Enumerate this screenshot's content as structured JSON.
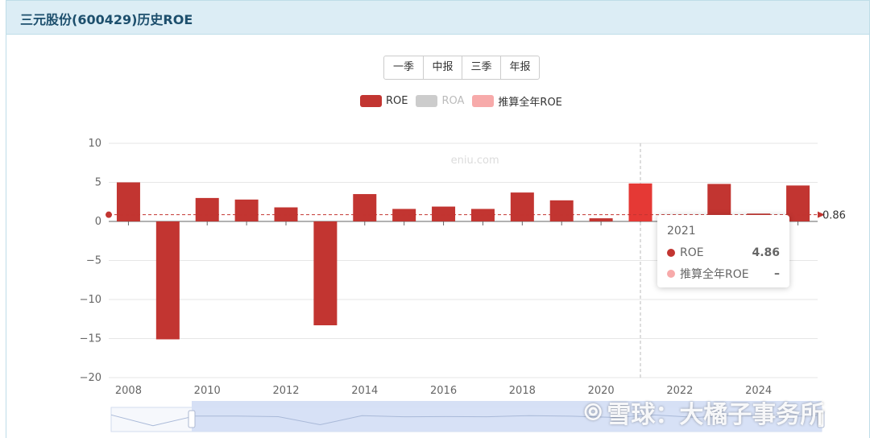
{
  "header": {
    "title": "三元股份(600429)历史ROE"
  },
  "period_buttons": [
    "一季",
    "中报",
    "三季",
    "年报"
  ],
  "colors": {
    "roe": "#c23531",
    "roa": "#cccccc",
    "estimate": "#f7aaaa",
    "hover_bar": "#e53935",
    "markline": "#c23531"
  },
  "chart_data": {
    "type": "bar",
    "legend": [
      "ROE",
      "ROA",
      "推算全年ROE"
    ],
    "legend_inactive": [
      "ROA"
    ],
    "x": [
      2008,
      2009,
      2010,
      2011,
      2012,
      2013,
      2014,
      2015,
      2016,
      2017,
      2018,
      2019,
      2020,
      2021,
      2022,
      2023,
      2024,
      2025
    ],
    "x_tick_labels": [
      "2008",
      "2010",
      "2012",
      "2014",
      "2016",
      "2018",
      "2020",
      "2022",
      "2024"
    ],
    "series": [
      {
        "name": "ROE",
        "values": [
          5.0,
          -15.1,
          3.0,
          2.8,
          1.8,
          -13.3,
          3.5,
          1.6,
          1.9,
          1.6,
          3.7,
          2.7,
          0.4,
          4.86,
          0.3,
          4.8,
          1.0,
          4.6
        ]
      }
    ],
    "ylim": [
      -20,
      10
    ],
    "y_ticks": [
      10,
      5,
      0,
      -5,
      -10,
      -15,
      -20
    ],
    "y_tick_labels": [
      "10",
      "5",
      "0",
      "−5",
      "−10",
      "−15",
      "−20"
    ],
    "average_line": {
      "value": 0.86,
      "label": "0.86"
    },
    "hover_index": 13,
    "watermark_text": "eniu.com",
    "grid": true
  },
  "tooltip": {
    "title": "2021",
    "rows": [
      {
        "name": "ROE",
        "value": "4.86"
      },
      {
        "name": "推算全年ROE",
        "value": "–"
      }
    ]
  },
  "watermark": {
    "text": "雪球：大橘子事务所"
  }
}
